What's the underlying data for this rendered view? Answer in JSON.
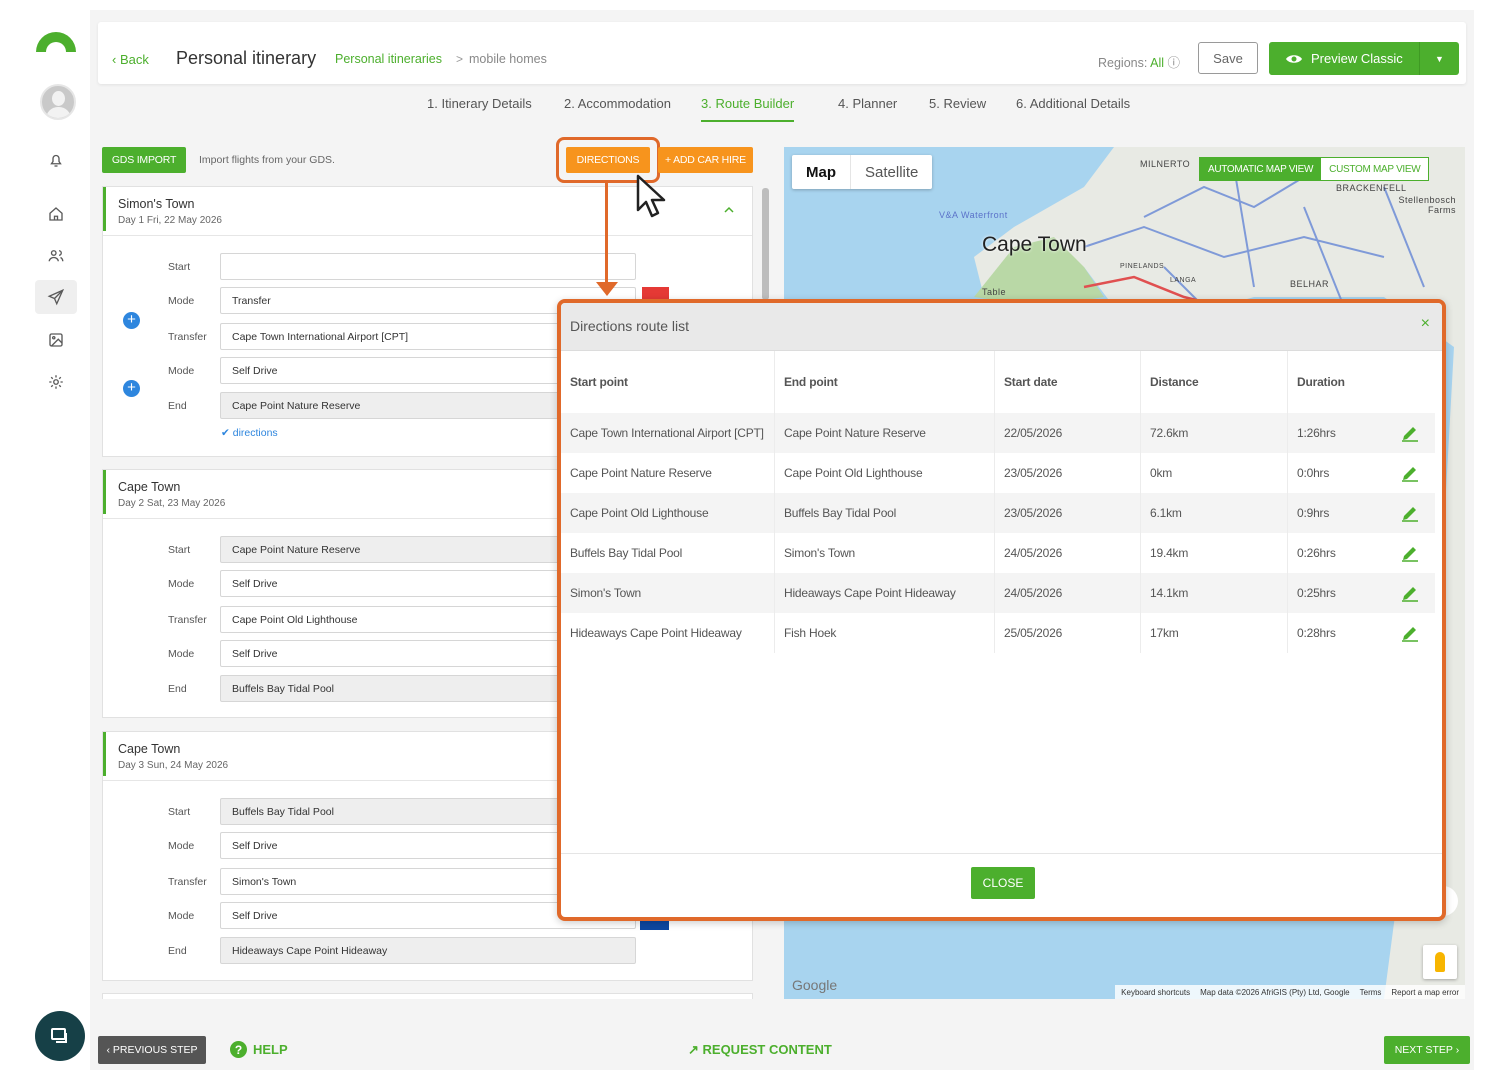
{
  "topbar": {
    "back_label": "Back",
    "title": "Personal itinerary",
    "breadcrumb_parent": "Personal itineraries",
    "breadcrumb_sep": ">",
    "breadcrumb_current": "mobile homes",
    "regions_label": "Regions:",
    "regions_value": "All",
    "save_label": "Save",
    "preview_label": "Preview Classic"
  },
  "steps": [
    {
      "label": "1. Itinerary Details"
    },
    {
      "label": "2. Accommodation"
    },
    {
      "label": "3. Route Builder"
    },
    {
      "label": "4. Planner"
    },
    {
      "label": "5. Review"
    },
    {
      "label": "6. Additional Details"
    }
  ],
  "toolbar": {
    "gds_label": "GDS IMPORT",
    "gds_hint": "Import flights from your GDS.",
    "directions_label": "DIRECTIONS",
    "car_hire_label": "+ ADD CAR HIRE"
  },
  "days": [
    {
      "place": "Simon's Town",
      "date": "Day 1  Fri, 22 May 2026",
      "fields": {
        "start_label": "Start",
        "start_value": "",
        "mode1_label": "Mode",
        "mode1_value": "Transfer",
        "transfer_label": "Transfer",
        "transfer_value": "Cape Town International Airport [CPT]",
        "mode2_label": "Mode",
        "mode2_value": "Self Drive",
        "end_label": "End",
        "end_value": "Cape Point Nature Reserve"
      },
      "directions_link": "directions"
    },
    {
      "place": "Cape Town",
      "date": "Day 2  Sat, 23 May 2026",
      "fields": {
        "start_label": "Start",
        "start_value": "Cape Point Nature Reserve",
        "mode1_label": "Mode",
        "mode1_value": "Self Drive",
        "transfer_label": "Transfer",
        "transfer_value": "Cape Point Old Lighthouse",
        "mode2_label": "Mode",
        "mode2_value": "Self Drive",
        "end_label": "End",
        "end_value": "Buffels Bay Tidal Pool"
      }
    },
    {
      "place": "Cape Town",
      "date": "Day 3  Sun, 24 May 2026",
      "fields": {
        "start_label": "Start",
        "start_value": "Buffels Bay Tidal Pool",
        "mode1_label": "Mode",
        "mode1_value": "Self Drive",
        "transfer_label": "Transfer",
        "transfer_value": "Simon's Town",
        "mode2_label": "Mode",
        "mode2_value": "Self Drive",
        "end_label": "End",
        "end_value": "Hideaways Cape Point Hideaway"
      }
    }
  ],
  "map": {
    "type_map": "Map",
    "type_satellite": "Satellite",
    "auto_view": "AUTOMATIC MAP VIEW",
    "custom_view": "CUSTOM MAP VIEW",
    "city_label": "Cape Town",
    "waterfront_label": "V&A Waterfront",
    "milnerton_label": "MILNERTO",
    "brackenfell_label": "BRACKENFELL",
    "stellenbosch_label": "Stellenbosch Farms",
    "pinelands_label": "PINELANDS",
    "langa_label": "LANGA",
    "belhar_label": "BELHAR",
    "table_label": "Table",
    "google_label": "Google",
    "footer": [
      "Keyboard shortcuts",
      "Map data ©2026 AfriGIS (Pty) Ltd, Google",
      "Terms",
      "Report a map error"
    ]
  },
  "modal": {
    "title": "Directions route list",
    "close_x": "×",
    "headers": [
      "Start point",
      "End point",
      "Start date",
      "Distance",
      "Duration"
    ],
    "rows": [
      {
        "start": "Cape Town International Airport [CPT]",
        "end": "Cape Point Nature Reserve",
        "date": "22/05/2026",
        "distance": "72.6km",
        "duration": "1:26hrs"
      },
      {
        "start": "Cape Point Nature Reserve",
        "end": "Cape Point Old Lighthouse",
        "date": "23/05/2026",
        "distance": "0km",
        "duration": "0:0hrs"
      },
      {
        "start": "Cape Point Old Lighthouse",
        "end": "Buffels Bay Tidal Pool",
        "date": "23/05/2026",
        "distance": "6.1km",
        "duration": "0:9hrs"
      },
      {
        "start": "Buffels Bay Tidal Pool",
        "end": "Simon's Town",
        "date": "24/05/2026",
        "distance": "19.4km",
        "duration": "0:26hrs"
      },
      {
        "start": "Simon's Town",
        "end": "Hideaways Cape Point Hideaway",
        "date": "24/05/2026",
        "distance": "14.1km",
        "duration": "0:25hrs"
      },
      {
        "start": "Hideaways Cape Point Hideaway",
        "end": "Fish Hoek",
        "date": "25/05/2026",
        "distance": "17km",
        "duration": "0:28hrs"
      }
    ],
    "close_label": "CLOSE"
  },
  "bottom": {
    "prev_label": "PREVIOUS STEP",
    "help_label": "HELP",
    "help_icon": "?",
    "request_label": "↗ REQUEST CONTENT",
    "next_label": "NEXT STEP"
  },
  "colors": {
    "brand_green": "#4caf2d",
    "accent_orange": "#f7941d",
    "annotation_orange": "#e0692a"
  }
}
